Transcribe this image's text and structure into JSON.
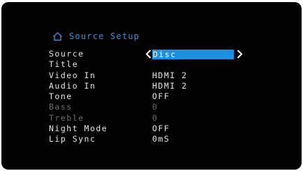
{
  "header": {
    "title": "Source Setup",
    "icon": "home-icon",
    "accent_color": "#3d8fd8"
  },
  "menu": {
    "source": {
      "label": "Source",
      "value": "Disc",
      "highlight_color": "#1f8fe0"
    },
    "title": {
      "label": "Title",
      "value": ""
    },
    "video_in": {
      "label": "Video In",
      "value": "HDMI 2"
    },
    "audio_in": {
      "label": "Audio In",
      "value": "HDMI 2"
    },
    "tone": {
      "label": "Tone",
      "value": "OFF"
    },
    "bass": {
      "label": "Bass",
      "value": "0",
      "disabled": true
    },
    "treble": {
      "label": "Treble",
      "value": "0",
      "disabled": true
    },
    "night_mode": {
      "label": "Night Mode",
      "value": "OFF"
    },
    "lip_sync": {
      "label": "Lip Sync",
      "value": "0mS"
    }
  }
}
